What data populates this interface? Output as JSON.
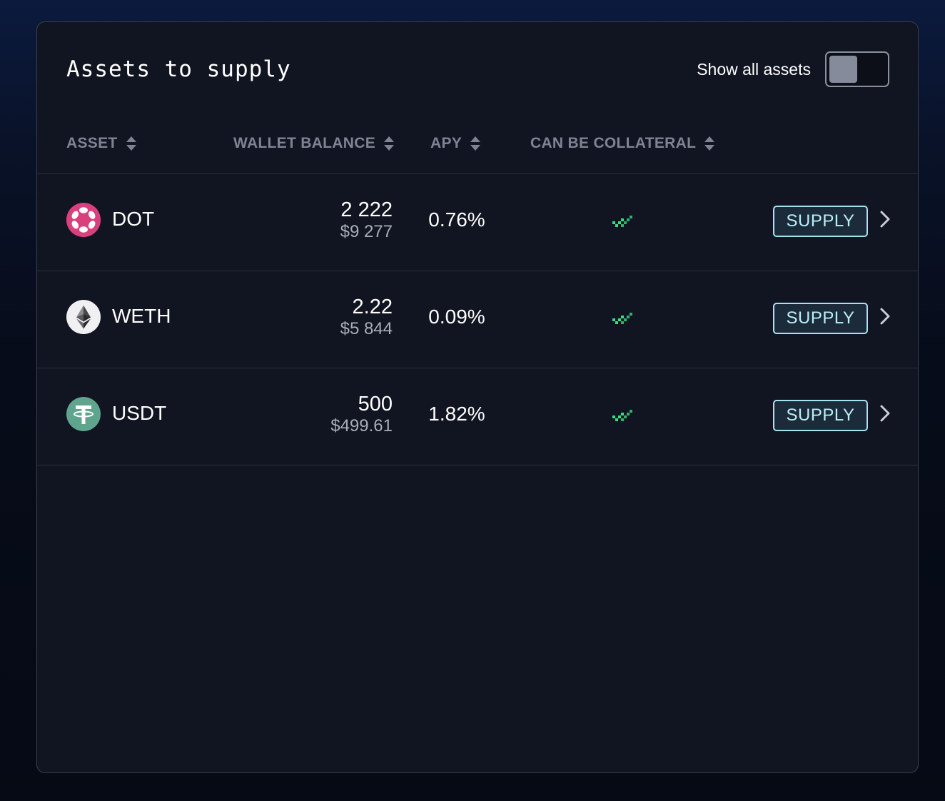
{
  "panel": {
    "title": "Assets to supply",
    "toggle": {
      "label": "Show all assets",
      "checked": false
    }
  },
  "table": {
    "columns": [
      {
        "label": "ASSET",
        "icon": "sort-icon"
      },
      {
        "label": "WALLET BALANCE",
        "icon": "sort-icon"
      },
      {
        "label": "APY",
        "icon": "sort-icon"
      },
      {
        "label": "CAN BE COLLATERAL",
        "icon": "sort-icon"
      }
    ],
    "rows": [
      {
        "symbol": "DOT",
        "icon": "polkadot-icon",
        "balance": "2 222",
        "balance_usd": "$9 277",
        "apy": "0.76%",
        "collateral": true,
        "action_label": "SUPPLY"
      },
      {
        "symbol": "WETH",
        "icon": "ethereum-icon",
        "balance": "2.22",
        "balance_usd": "$5 844",
        "apy": "0.09%",
        "collateral": true,
        "action_label": "SUPPLY"
      },
      {
        "symbol": "USDT",
        "icon": "tether-icon",
        "balance": "500",
        "balance_usd": "$499.61",
        "apy": "1.82%",
        "collateral": true,
        "action_label": "SUPPLY"
      }
    ]
  },
  "colors": {
    "panel_bg": "#111421",
    "accent": "#a6e3f0",
    "check_green": "#3ddc84",
    "muted_text": "#7f8494"
  }
}
